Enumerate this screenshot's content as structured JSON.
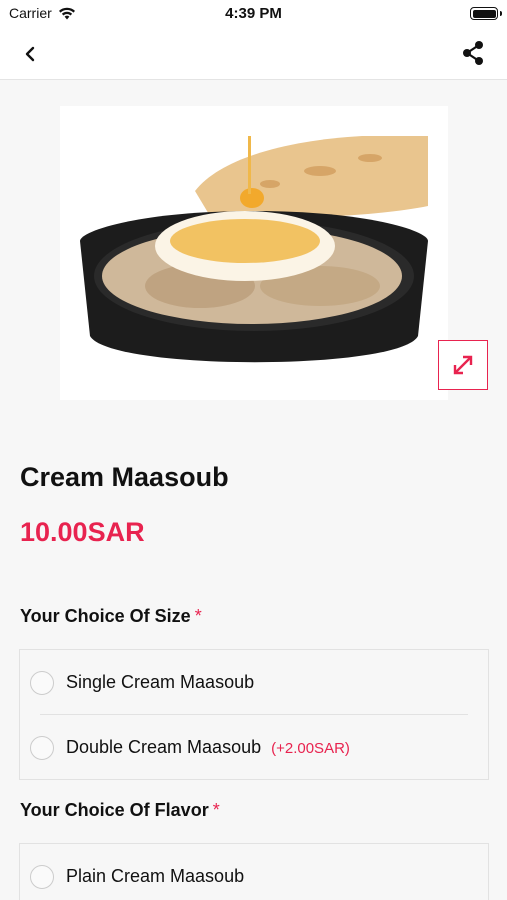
{
  "status_bar": {
    "carrier": "Carrier",
    "time": "4:39 PM"
  },
  "product": {
    "name": "Cream Maasoub",
    "price": "10.00SAR"
  },
  "size_section": {
    "title": "Your Choice Of Size",
    "required_marker": "*",
    "options": [
      {
        "label": "Single Cream Maasoub",
        "extra": ""
      },
      {
        "label": "Double Cream Maasoub",
        "extra": "(+2.00SAR)"
      }
    ]
  },
  "flavor_section": {
    "title": "Your Choice Of Flavor",
    "required_marker": "*",
    "options": [
      {
        "label": "Plain Cream Maasoub",
        "extra": ""
      }
    ]
  },
  "colors": {
    "accent": "#e8234f"
  },
  "icons": {
    "back": "chevron-left-icon",
    "share": "share-icon",
    "expand": "expand-icon",
    "wifi": "wifi-icon",
    "battery": "battery-icon"
  }
}
